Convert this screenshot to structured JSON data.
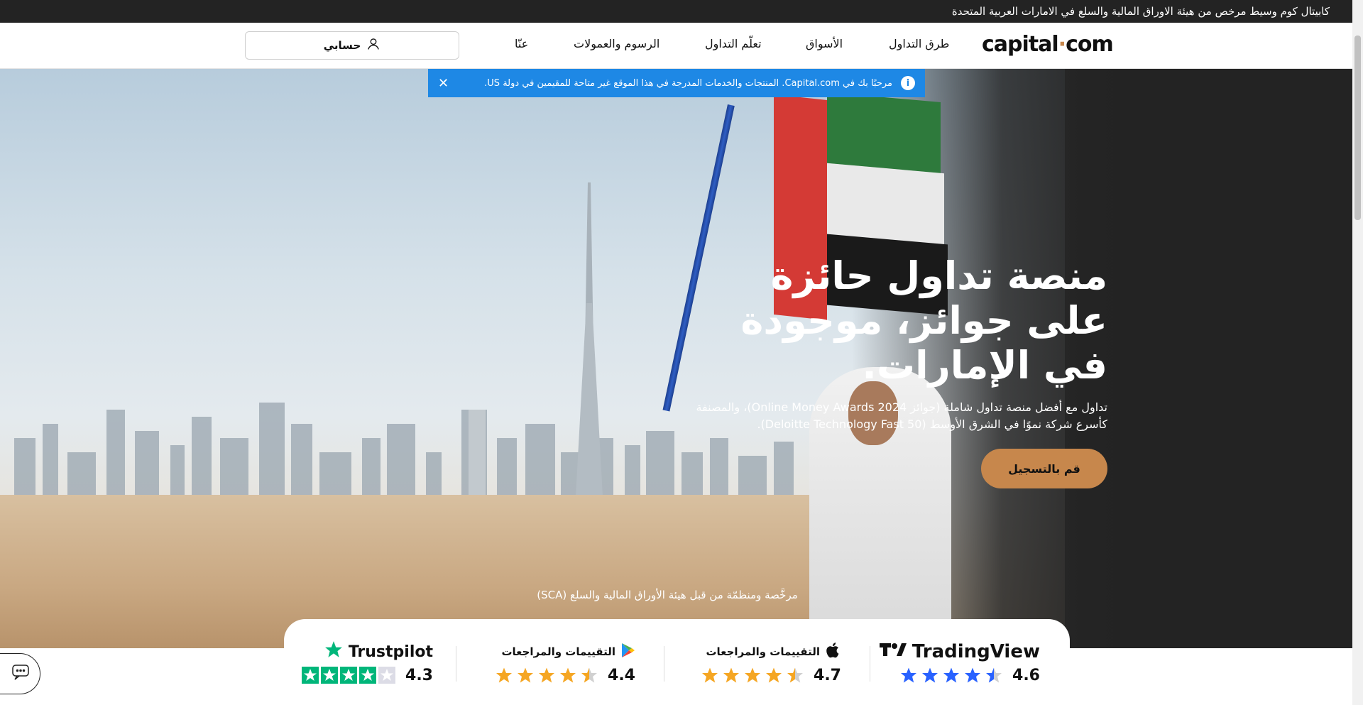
{
  "topbar": {
    "text": "كابيتال كوم وسيط مرخص من هيئة الاوراق المالية والسلع في الامارات العربية المتحدة"
  },
  "header": {
    "logo_text_a": "capital",
    "logo_text_dot": "·",
    "logo_text_b": "com",
    "nav": {
      "ways": "طرق التداول",
      "markets": "الأسواق",
      "learn": "تعلّم التداول",
      "fees": "الرسوم والعمولات",
      "about": "عنّا"
    },
    "account_label": "حسابي"
  },
  "notice": {
    "text": "مرحبًا بك في Capital.com. المنتجات والخدمات المدرجة في هذا الموقع غير متاحة للمقيمين في دولة US.",
    "close": "✕"
  },
  "hero": {
    "title": "منصة تداول حائزة على جوائز، موجودة في الإمارات.",
    "subtitle": "تداول مع أفضل منصة تداول شاملة (جوائز Online Money Awards 2024)، والمصنفة كأسرع شركة نموًا في الشرق الأوسط (Deloitte Technology Fast 50).",
    "cta": "قم بالتسجيل",
    "regulated": "مرخَّصة ومنظمّة من قبل هيئة الأوراق المالية والسلع (SCA)"
  },
  "ratings": [
    {
      "brand": "TradingView",
      "score": "4.6",
      "stars": 4.5,
      "color": "#2962ff"
    },
    {
      "brand": "التقييمات والمراجعات",
      "score": "4.7",
      "stars": 4.5,
      "color": "#f5a623"
    },
    {
      "brand": "التقييمات والمراجعات",
      "score": "4.4",
      "stars": 4.5,
      "color": "#f5a623"
    },
    {
      "brand": "Trustpilot",
      "score": "4.3",
      "stars": 4.5,
      "color": "#00b67a"
    }
  ],
  "icons": {
    "user": "user-icon",
    "info": "info-icon",
    "apple": "apple-icon",
    "google_play": "google-play-icon",
    "trustpilot_star": "trustpilot-star-icon",
    "tradingview": "tradingview-logo-icon",
    "chat": "chat-icon"
  }
}
